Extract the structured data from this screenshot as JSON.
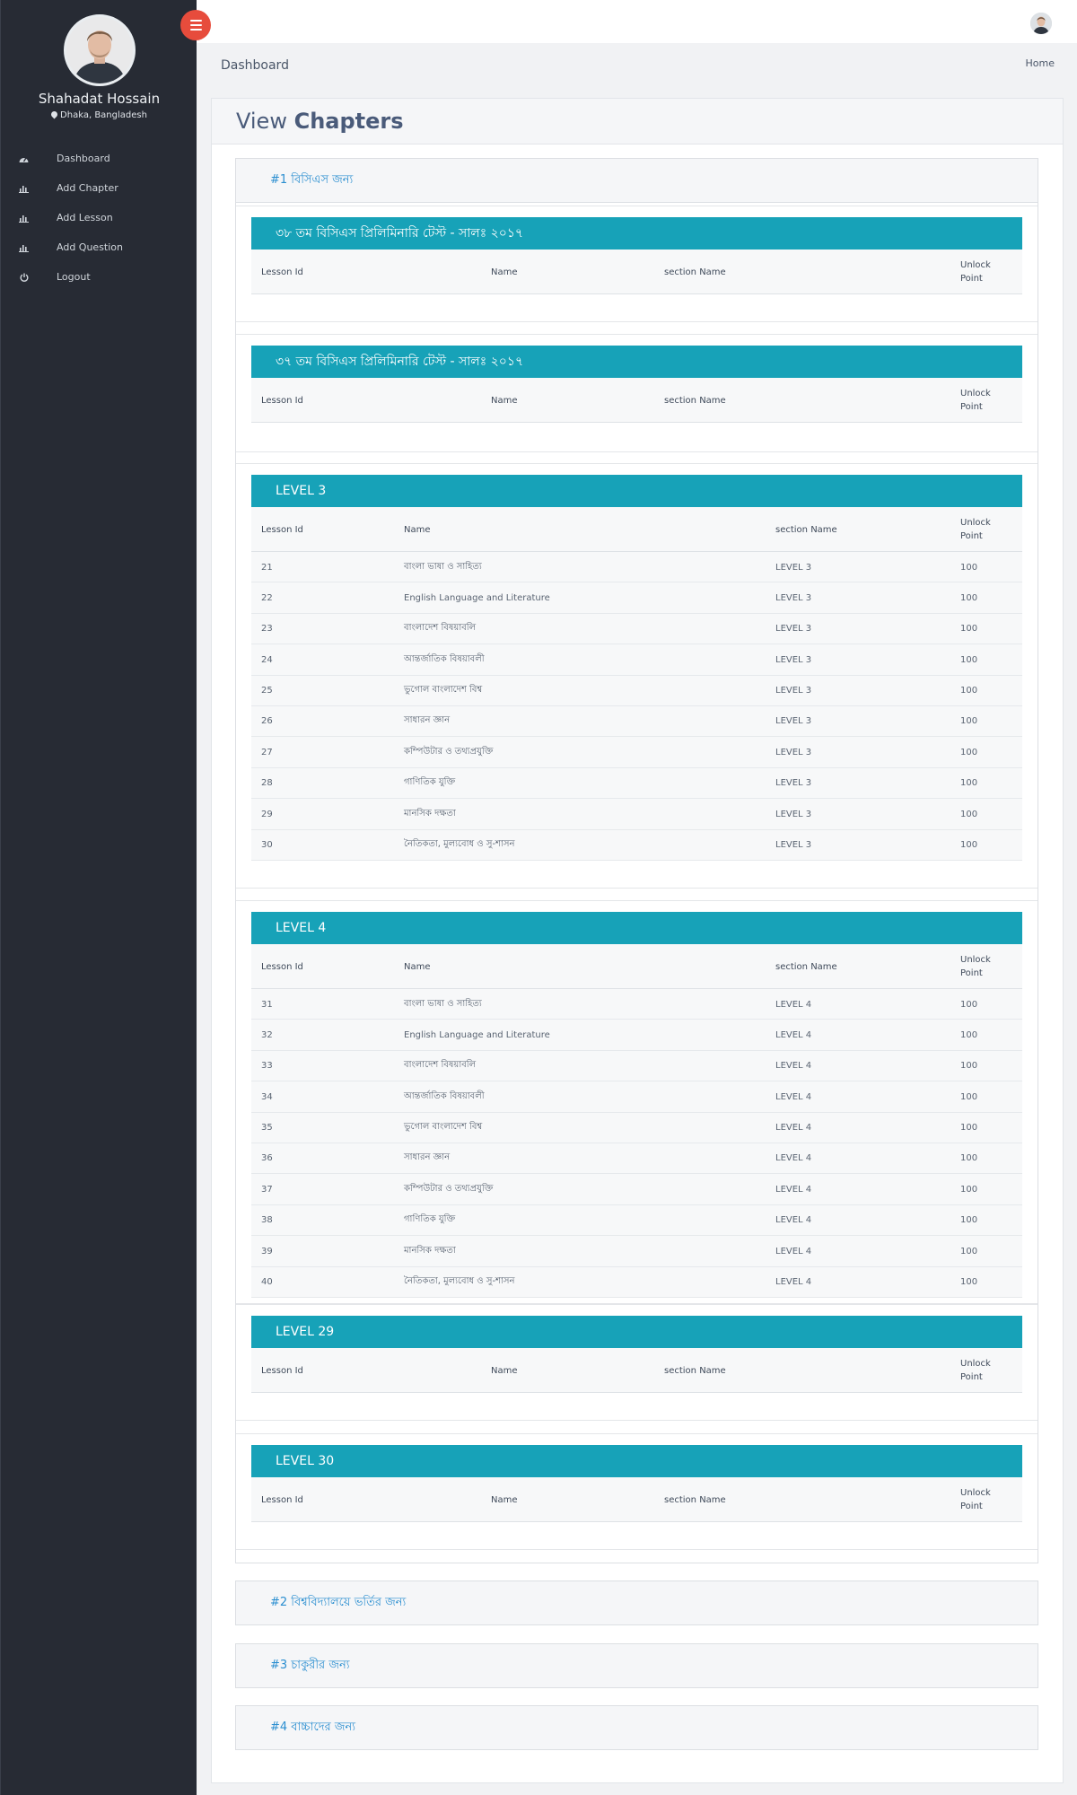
{
  "user": {
    "name": "Shahadat Hossain",
    "location": "Dhaka, Bangladesh"
  },
  "nav": [
    {
      "label": "Dashboard",
      "icon": "dashboard-icon"
    },
    {
      "label": "Add Chapter",
      "icon": "bar-chart-icon"
    },
    {
      "label": "Add Lesson",
      "icon": "bar-chart-icon"
    },
    {
      "label": "Add Question",
      "icon": "bar-chart-icon"
    },
    {
      "label": "Logout",
      "icon": "power-icon"
    }
  ],
  "breadcrumb": {
    "title": "Dashboard",
    "home": "Home"
  },
  "page": {
    "title_light": "View ",
    "title_bold": "Chapters"
  },
  "table_headers": {
    "lesson_id": "Lesson Id",
    "name": "Name",
    "section": "section Name",
    "unlock_1": "Unlock",
    "unlock_2": "Point"
  },
  "chapters": [
    {
      "heading": "#1 বিসিএস জন্য"
    },
    {
      "heading": "#2 বিশ্ববিদ্যালয়ে ভর্তির জন্য"
    },
    {
      "heading": "#3 চাকুরীর জন্য"
    },
    {
      "heading": "#4 বাচ্চাদের জন্য"
    }
  ],
  "sections": [
    {
      "title": "৩৮ তম বিসিএস প্রিলিমিনারি টেস্ট - সালঃ ২০১৭",
      "rows": []
    },
    {
      "title": "৩৭ তম বিসিএস প্রিলিমিনারি টেস্ট - সালঃ ২০১৭",
      "rows": []
    },
    {
      "title": "LEVEL 3",
      "rows": [
        [
          "21",
          "বাংলা ভাষা ও সাহিত্য",
          "LEVEL 3",
          "100"
        ],
        [
          "22",
          "English Language and Literature",
          "LEVEL 3",
          "100"
        ],
        [
          "23",
          "বাংলাদেশ বিষয়াবলি",
          "LEVEL 3",
          "100"
        ],
        [
          "24",
          "আন্তর্জাতিক বিষয়াবলী",
          "LEVEL 3",
          "100"
        ],
        [
          "25",
          "ভুগোল বাংলাদেশ বিশ্ব",
          "LEVEL 3",
          "100"
        ],
        [
          "26",
          "সাধারন জ্ঞান",
          "LEVEL 3",
          "100"
        ],
        [
          "27",
          "কম্পিউটার ও তথ্যপ্রযুক্তি",
          "LEVEL 3",
          "100"
        ],
        [
          "28",
          "গাণিতিক যুক্তি",
          "LEVEL 3",
          "100"
        ],
        [
          "29",
          "মানসিক দক্ষতা",
          "LEVEL 3",
          "100"
        ],
        [
          "30",
          "নৈতিকতা, মুল্যবোধ ও সু-শাসন",
          "LEVEL 3",
          "100"
        ]
      ]
    },
    {
      "title": "LEVEL 4",
      "rows": [
        [
          "31",
          "বাংলা ভাষা ও সাহিত্য",
          "LEVEL 4",
          "100"
        ],
        [
          "32",
          "English Language and Literature",
          "LEVEL 4",
          "100"
        ],
        [
          "33",
          "বাংলাদেশ বিষয়াবলি",
          "LEVEL 4",
          "100"
        ],
        [
          "34",
          "আন্তর্জাতিক বিষয়াবলী",
          "LEVEL 4",
          "100"
        ],
        [
          "35",
          "ভুগোল বাংলাদেশ বিশ্ব",
          "LEVEL 4",
          "100"
        ],
        [
          "36",
          "সাধারন জ্ঞান",
          "LEVEL 4",
          "100"
        ],
        [
          "37",
          "কম্পিউটার ও তথ্যপ্রযুক্তি",
          "LEVEL 4",
          "100"
        ],
        [
          "38",
          "গাণিতিক যুক্তি",
          "LEVEL 4",
          "100"
        ],
        [
          "39",
          "মানসিক দক্ষতা",
          "LEVEL 4",
          "100"
        ],
        [
          "40",
          "নৈতিকতা, মুল্যবোধ ও সু-শাসন",
          "LEVEL 4",
          "100"
        ]
      ]
    },
    {
      "title": "LEVEL 29",
      "rows": []
    },
    {
      "title": "LEVEL 30",
      "rows": []
    }
  ],
  "colors": {
    "sidebar": "#272b34",
    "accent": "#17a2b8",
    "toggle": "#e74c3c",
    "link": "#2a8ed0"
  }
}
